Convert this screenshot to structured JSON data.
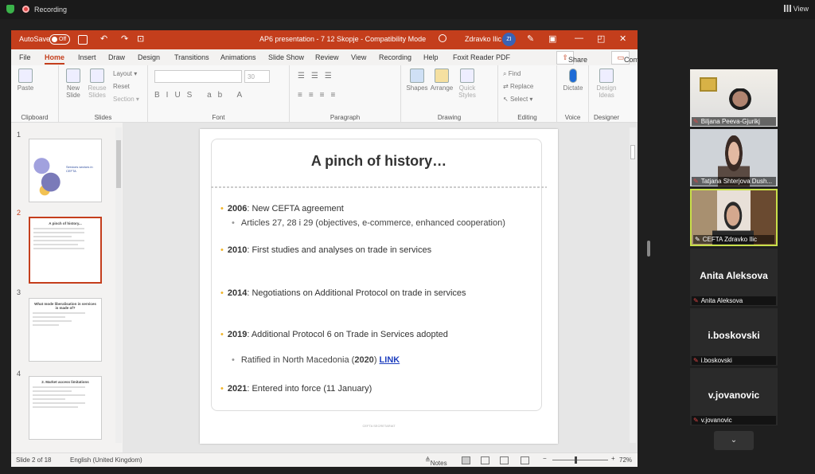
{
  "zoom_top": {
    "recording_label": "Recording",
    "view_label": "View"
  },
  "ppt": {
    "title_bar": {
      "autosave": "AutoSave",
      "autosave_state": "Off",
      "doc_title": "AP6 presentation - 7 12 Skopje  -  Compatibility Mode",
      "user_name": "Zdravko Ilic",
      "user_initials": "ZI"
    },
    "menu": {
      "items": [
        "File",
        "Home",
        "Insert",
        "Draw",
        "Design",
        "Transitions",
        "Animations",
        "Slide Show",
        "Review",
        "View",
        "Recording",
        "Help",
        "Foxit Reader PDF"
      ],
      "share": "Share",
      "comments": "Comments"
    },
    "ribbon": {
      "clipboard": {
        "paste": "Paste",
        "label": "Clipboard"
      },
      "slides": {
        "new_slide": "New Slide",
        "reuse": "Reuse Slides",
        "layout": "Layout",
        "reset": "Reset",
        "section": "Section",
        "label": "Slides"
      },
      "font": {
        "size": "30",
        "label": "Font"
      },
      "paragraph": {
        "label": "Paragraph"
      },
      "drawing": {
        "shapes": "Shapes",
        "arrange": "Arrange",
        "quick_styles": "Quick Styles",
        "label": "Drawing"
      },
      "editing": {
        "find": "Find",
        "replace": "Replace",
        "select": "Select",
        "label": "Editing"
      },
      "voice": {
        "dictate": "Dictate",
        "label": "Voice"
      },
      "designer": {
        "design_ideas": "Design Ideas",
        "label": "Designer"
      }
    },
    "thumbnails": [
      {
        "num": "1",
        "title": "Services sectors in CEFTA"
      },
      {
        "num": "2",
        "title": "A pinch of history..."
      },
      {
        "num": "3",
        "title": "What mode liberalisation in services is made of?"
      },
      {
        "num": "4",
        "title": "2. Market access limitations"
      }
    ],
    "slide": {
      "title": "A pinch of history…",
      "b1_year": "2006",
      "b1_text": ": New CEFTA agreement",
      "b1_sub": "Articles 27, 28 i 29 (objectives, e-commerce, enhanced cooperation)",
      "b2_year": "2010",
      "b2_text": ": First studies and analyses on trade in services",
      "b3_year": "2014",
      "b3_text": ": Negotiations on Additional Protocol on trade in services",
      "b4_year": "2019",
      "b4_text": ": Additional Protocol 6 on Trade in Services adopted",
      "b4_sub_a": "Ratified in North Macedonia (",
      "b4_sub_year": "2020",
      "b4_sub_b": ") ",
      "b4_link": "LINK",
      "b5_year": "2021",
      "b5_text": ": Entered into force (11 January)",
      "footer": "CEFTA SECRETARIAT"
    },
    "status": {
      "slide_of": "Slide 2 of 18",
      "language": "English (United Kingdom)",
      "notes": "Notes",
      "zoom": "72%"
    }
  },
  "participants": [
    {
      "name": "Biljana Peeva-Gjurikj",
      "video": true
    },
    {
      "name": "Tatjana Shterjova Dush...",
      "video": true
    },
    {
      "name": "CEFTA Zdravko Ilic",
      "video": true,
      "active": true
    },
    {
      "display": "Anita Aleksova",
      "name": "Anita Aleksova",
      "video": false
    },
    {
      "display": "i.boskovski",
      "name": "i.boskovski",
      "video": false
    },
    {
      "display": "v.jovanovic",
      "name": "v.jovanovic",
      "video": false
    }
  ]
}
